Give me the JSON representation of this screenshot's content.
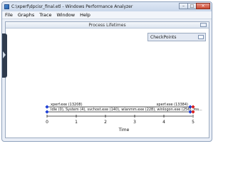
{
  "window": {
    "title": "C:\\xperf\\dpcisr_final.etl - Windows Performance Analyzer"
  },
  "controls": {
    "minimize": "–",
    "maximize": "□",
    "close": "×"
  },
  "menu": [
    "File",
    "Graphs",
    "Trace",
    "Window",
    "Help"
  ],
  "graph": {
    "title": "Process Lifetimes",
    "checkpoints_label": "CheckPoints",
    "axis_title": "Time",
    "ticks": [
      "0",
      "1",
      "2",
      "3",
      "4",
      "5"
    ],
    "rows": [
      {
        "left_label": "xperf.exe (13208)",
        "right_label": "xperf.exe (13384)"
      },
      {
        "left_label": "Idle (0), System (4), svchost.exe (140), wlanmm.exe (228), winlogon.exe (256), ms...",
        "right_label": ""
      }
    ],
    "colors": {
      "start_marker": "#1d3fd6",
      "end_marker": "#d81b1b",
      "row_line": "#1a1a1a"
    }
  }
}
